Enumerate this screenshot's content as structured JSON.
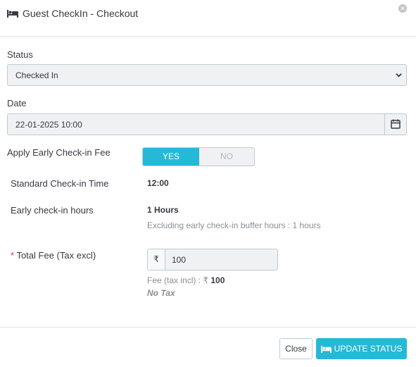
{
  "modal": {
    "title": "Guest CheckIn - Checkout",
    "close_icon": "close-circle-icon",
    "title_icon": "bed-icon"
  },
  "status": {
    "label": "Status",
    "selected": "Checked In"
  },
  "date": {
    "label": "Date",
    "value": "22-01-2025 10:00",
    "icon": "calendar-icon"
  },
  "early_fee": {
    "label": "Apply Early Check-in Fee",
    "yes_label": "YES",
    "no_label": "NO",
    "selected": "YES"
  },
  "standard_checkin": {
    "label": "Standard Check-in Time",
    "value": "12:00"
  },
  "early_hours": {
    "label": "Early check-in hours",
    "value": "1 Hours",
    "help": "Excluding early check-in buffer hours : 1 hours"
  },
  "total_fee": {
    "required_mark": "*",
    "label": "Total Fee (Tax excl)",
    "currency": "₹",
    "value": "100",
    "tax_incl_label": "Fee (tax incl) : ₹",
    "tax_incl_value": "100",
    "tax_note": "No Tax"
  },
  "footer": {
    "close_label": "Close",
    "update_label": "UPDATE STATUS"
  },
  "colors": {
    "accent": "#25b9d7",
    "required": "#e0333c",
    "field_bg": "#eff1f2",
    "border": "#bbcdd2"
  }
}
